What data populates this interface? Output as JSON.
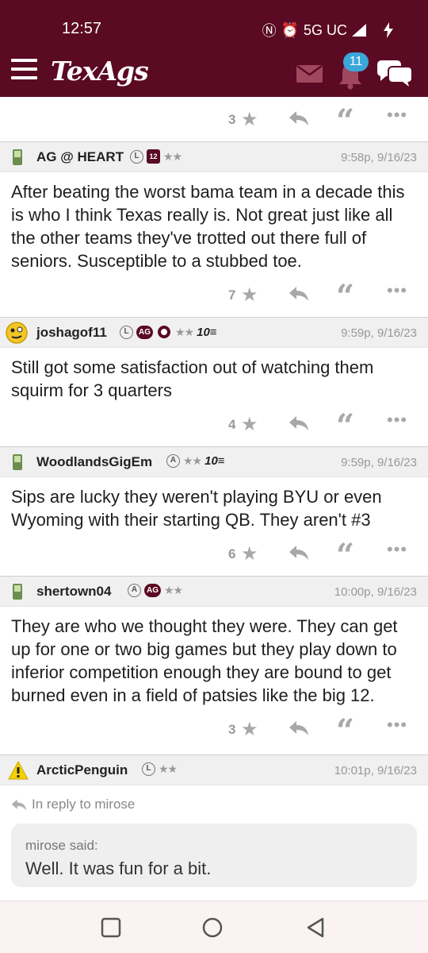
{
  "status": {
    "time": "12:57",
    "network": "5G UC"
  },
  "app": {
    "logo": "TexAgs",
    "notification_count": "11",
    "icons": [
      "menu-icon",
      "mail-icon",
      "bell-icon",
      "chat-icon"
    ],
    "brand_color": "#5b0a23"
  },
  "top_actions": {
    "count": "3"
  },
  "posts": [
    {
      "user": "AG @ HEART",
      "badges": [
        "L",
        "12",
        "**"
      ],
      "time": "9:58p, 9/16/23",
      "body": "After beating the worst bama team in a decade this is who I think Texas really is. Not great just like all the other teams they've trotted out there full of seniors. Susceptible to a stubbed toe.",
      "likes": "7"
    },
    {
      "user": "joshagof11",
      "badges": [
        "L",
        "AG",
        "**",
        "10"
      ],
      "time": "9:59p, 9/16/23",
      "body": "Still got some satisfaction out of watching them squirm for 3 quarters",
      "likes": "4"
    },
    {
      "user": "WoodlandsGigEm",
      "badges": [
        "A",
        "**",
        "10"
      ],
      "time": "9:59p, 9/16/23",
      "body": "Sips are lucky they weren't playing BYU or even Wyoming with their starting QB. They aren't #3",
      "likes": "6"
    },
    {
      "user": "shertown04",
      "badges": [
        "A",
        "AG",
        "**"
      ],
      "time": "10:00p, 9/16/23",
      "body": "They are who we thought they were. They can get up for one or two big games but they play down to inferior competition enough they are bound to get burned even in a field of patsies like the big 12.",
      "likes": "3"
    },
    {
      "user": "ArcticPenguin",
      "badges": [
        "L",
        "**"
      ],
      "time": "10:01p, 9/16/23",
      "reply_to": "In reply to mirose",
      "quote_said": "mirose said:",
      "quote_text": "Well. It was fun for a bit."
    }
  ],
  "labels": {
    "stars": "★★",
    "ten": "10≡",
    "star": "★",
    "more": "•••",
    "quote": "“"
  }
}
